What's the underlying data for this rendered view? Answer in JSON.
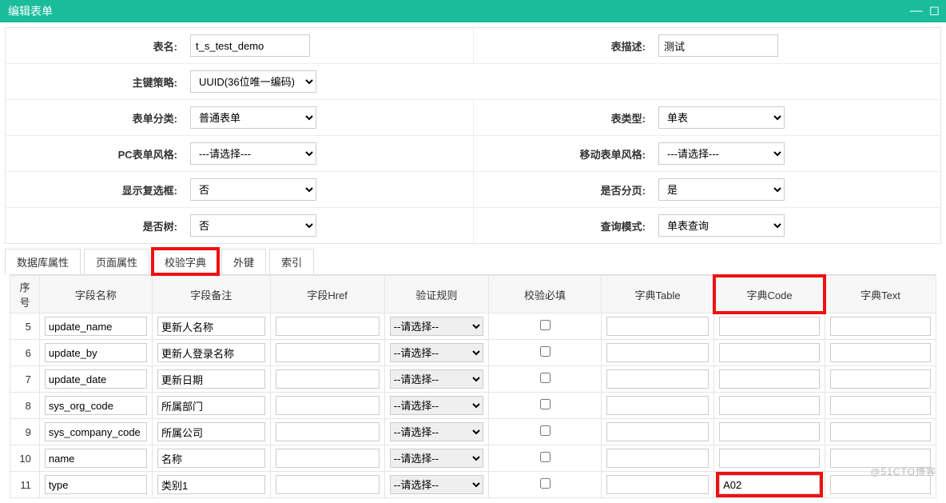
{
  "title": "编辑表单",
  "form": {
    "table_name": {
      "label": "表名:",
      "value": "t_s_test_demo"
    },
    "table_desc": {
      "label": "表描述:",
      "value": "测试"
    },
    "pk_strategy": {
      "label": "主键策略:",
      "value": "UUID(36位唯一编码)"
    },
    "form_category": {
      "label": "表单分类:",
      "value": "普通表单"
    },
    "form_type": {
      "label": "表类型:",
      "value": "单表"
    },
    "pc_style": {
      "label": "PC表单风格:",
      "value": "---请选择---"
    },
    "mobile_style": {
      "label": "移动表单风格:",
      "value": "---请选择---"
    },
    "show_checkbox": {
      "label": "显示复选框:",
      "value": "否"
    },
    "paging": {
      "label": "是否分页:",
      "value": "是"
    },
    "is_tree": {
      "label": "是否树:",
      "value": "否"
    },
    "query_mode": {
      "label": "查询模式:",
      "value": "单表查询"
    }
  },
  "tabs": [
    {
      "key": "db",
      "label": "数据库属性"
    },
    {
      "key": "page",
      "label": "页面属性"
    },
    {
      "key": "dict",
      "label": "校验字典",
      "active": true
    },
    {
      "key": "fk",
      "label": "外键"
    },
    {
      "key": "index",
      "label": "索引"
    }
  ],
  "columns": {
    "idx": "序号",
    "field_name": "字段名称",
    "field_remark": "字段备注",
    "field_href": "字段Href",
    "validate_rule": "验证规则",
    "required": "校验必填",
    "dict_table": "字典Table",
    "dict_code": "字典Code",
    "dict_text": "字典Text"
  },
  "rule_placeholder": "--请选择--",
  "rows": [
    {
      "idx": 5,
      "field_name": "update_name",
      "field_remark": "更新人名称",
      "field_href": "",
      "rule": "--请选择--",
      "required": false,
      "dict_table": "",
      "dict_code": "",
      "dict_text": ""
    },
    {
      "idx": 6,
      "field_name": "update_by",
      "field_remark": "更新人登录名称",
      "field_href": "",
      "rule": "--请选择--",
      "required": false,
      "dict_table": "",
      "dict_code": "",
      "dict_text": ""
    },
    {
      "idx": 7,
      "field_name": "update_date",
      "field_remark": "更新日期",
      "field_href": "",
      "rule": "--请选择--",
      "required": false,
      "dict_table": "",
      "dict_code": "",
      "dict_text": ""
    },
    {
      "idx": 8,
      "field_name": "sys_org_code",
      "field_remark": "所属部门",
      "field_href": "",
      "rule": "--请选择--",
      "required": false,
      "dict_table": "",
      "dict_code": "",
      "dict_text": ""
    },
    {
      "idx": 9,
      "field_name": "sys_company_code",
      "field_remark": "所属公司",
      "field_href": "",
      "rule": "--请选择--",
      "required": false,
      "dict_table": "",
      "dict_code": "",
      "dict_text": ""
    },
    {
      "idx": 10,
      "field_name": "name",
      "field_remark": "名称",
      "field_href": "",
      "rule": "--请选择--",
      "required": false,
      "dict_table": "",
      "dict_code": "",
      "dict_text": ""
    },
    {
      "idx": 11,
      "field_name": "type",
      "field_remark": "类别1",
      "field_href": "",
      "rule": "--请选择--",
      "required": false,
      "dict_table": "",
      "dict_code": "A02",
      "dict_text": "",
      "highlight_code": true
    }
  ],
  "watermark": "@51CTO博客"
}
